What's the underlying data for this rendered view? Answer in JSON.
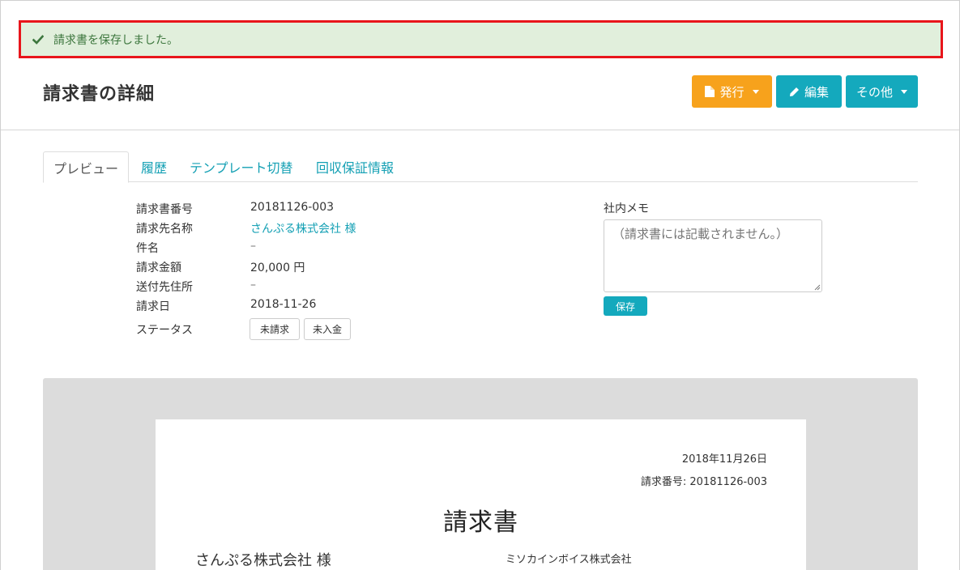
{
  "alert": {
    "message": "請求書を保存しました。",
    "icon": "check-icon",
    "color": "#3c763d"
  },
  "header": {
    "title": "請求書の詳細",
    "buttons": {
      "issue": {
        "label": "発行",
        "color": "#f7a21c"
      },
      "edit": {
        "label": "編集",
        "color": "#14a9bd"
      },
      "other": {
        "label": "その他",
        "color": "#14a9bd"
      }
    }
  },
  "tabs": [
    {
      "label": "プレビュー",
      "active": true
    },
    {
      "label": "履歴",
      "active": false
    },
    {
      "label": "テンプレート切替",
      "active": false
    },
    {
      "label": "回収保証情報",
      "active": false
    }
  ],
  "info": {
    "invoice_number": {
      "label": "請求書番号",
      "value": "20181126-003"
    },
    "client_name": {
      "label": "請求先名称",
      "value": "さんぷる株式会社 様"
    },
    "subject": {
      "label": "件名",
      "value": "–"
    },
    "amount": {
      "label": "請求金額",
      "value": "20,000 円"
    },
    "address": {
      "label": "送付先住所",
      "value": "–"
    },
    "billing_date": {
      "label": "請求日",
      "value": "2018-11-26"
    },
    "status": {
      "label": "ステータス",
      "badges": [
        "未請求",
        "未入金"
      ]
    }
  },
  "memo": {
    "label": "社内メモ",
    "placeholder": "（請求書には記載されません。）",
    "save_label": "保存"
  },
  "document": {
    "date": "2018年11月26日",
    "number": "請求番号: 20181126-003",
    "title": "請求書",
    "client": "さんぷる株式会社 様",
    "company": "ミソカインボイス株式会社"
  }
}
